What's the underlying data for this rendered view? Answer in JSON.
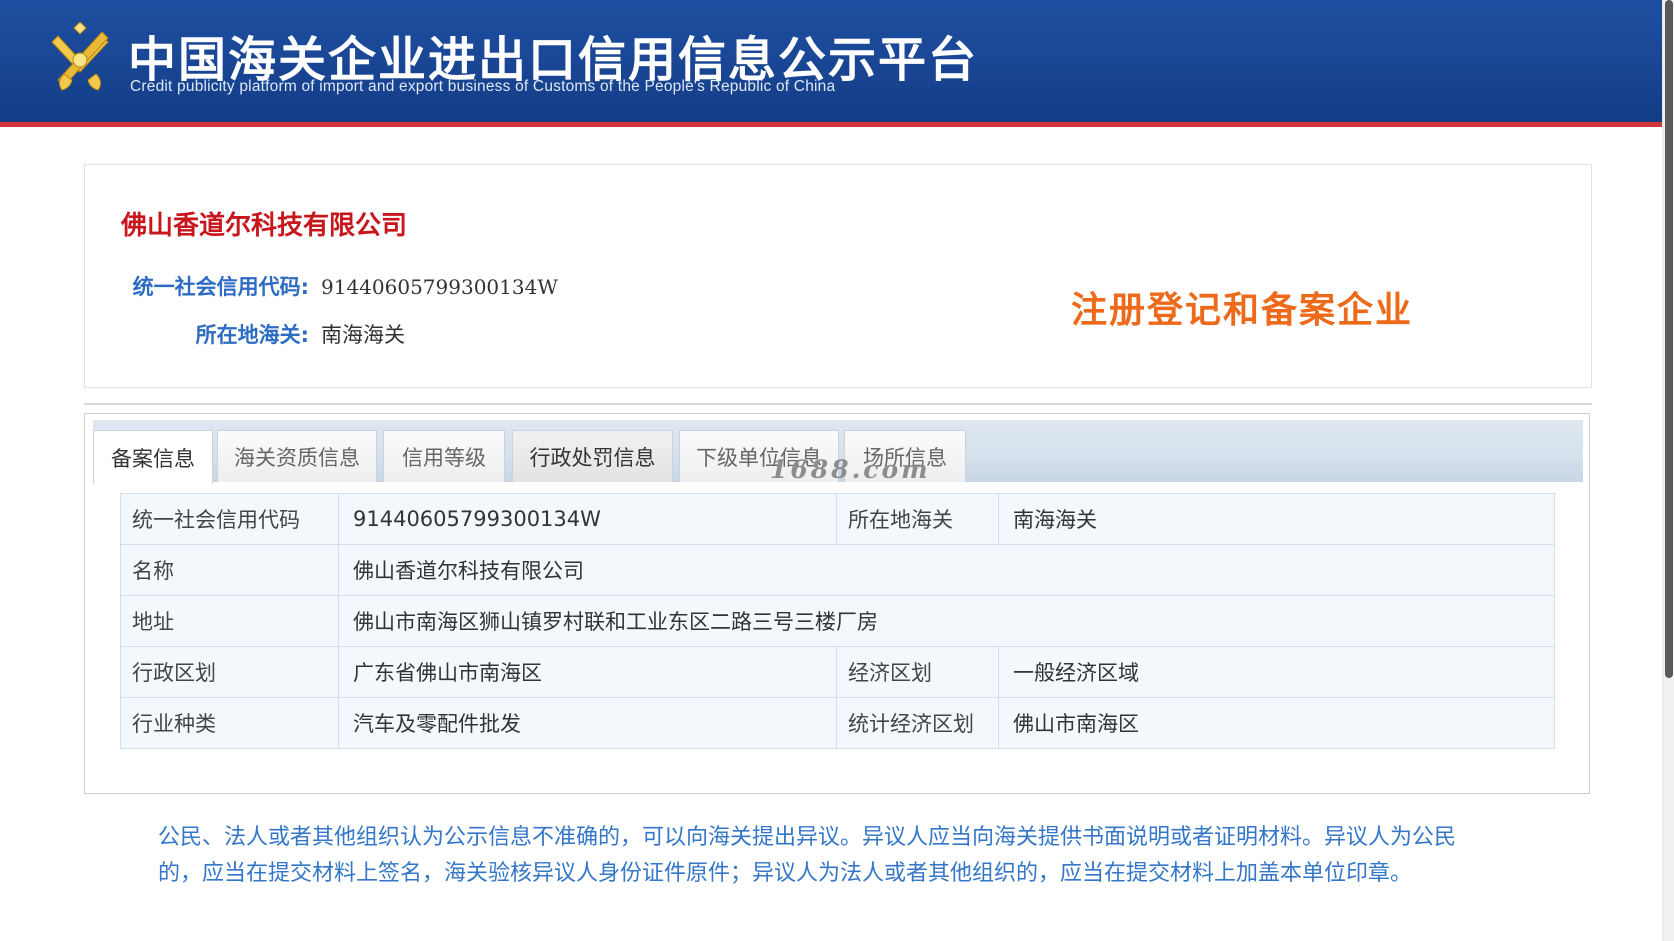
{
  "header": {
    "logo_icon": "customs-emblem-icon",
    "title": "中国海关企业进出口信用信息公示平台",
    "subtitle": "Credit publicity platform of import and export business of Customs of the People's Republic of China"
  },
  "summary": {
    "company_name": "佛山香道尔科技有限公司",
    "credit_code_label": "统一社会信用代码:",
    "credit_code_value": "91440605799300134W",
    "customs_label": "所在地海关:",
    "customs_value": "南海海关",
    "status_stamp": "注册登记和备案企业"
  },
  "tabs": [
    {
      "label": "备案信息",
      "active": true
    },
    {
      "label": "海关资质信息",
      "active": false
    },
    {
      "label": "信用等级",
      "active": false
    },
    {
      "label": "行政处罚信息",
      "active": false
    },
    {
      "label": "下级单位信息",
      "active": false
    },
    {
      "label": "场所信息",
      "active": false
    }
  ],
  "watermark": "1688.com",
  "detail": {
    "credit_code_label": "统一社会信用代码",
    "credit_code_value": "91440605799300134W",
    "customs_label": "所在地海关",
    "customs_value": "南海海关",
    "name_label": "名称",
    "name_value": "佛山香道尔科技有限公司",
    "address_label": "地址",
    "address_value": "佛山市南海区狮山镇罗村联和工业东区二路三号三楼厂房",
    "admin_region_label": "行政区划",
    "admin_region_value": "广东省佛山市南海区",
    "econ_region_label": "经济区划",
    "econ_region_value": "一般经济区域",
    "industry_label": "行业种类",
    "industry_value": "汽车及零配件批发",
    "stat_region_label": "统计经济区划",
    "stat_region_value": "佛山市南海区"
  },
  "notice": "公民、法人或者其他组织认为公示信息不准确的，可以向海关提出异议。异议人应当向海关提供书面说明或者证明材料。异议人为公民的，应当在提交材料上签名，海关验核异议人身份证件原件；异议人为法人或者其他组织的，应当在提交材料上加盖本单位印章。",
  "colors": {
    "header_blue": "#1a4796",
    "header_red_line": "#d2363a",
    "company_red": "#c8161d",
    "label_blue": "#2d6cc2",
    "stamp_orange": "#ec6a1a",
    "notice_blue": "#3476c8"
  }
}
